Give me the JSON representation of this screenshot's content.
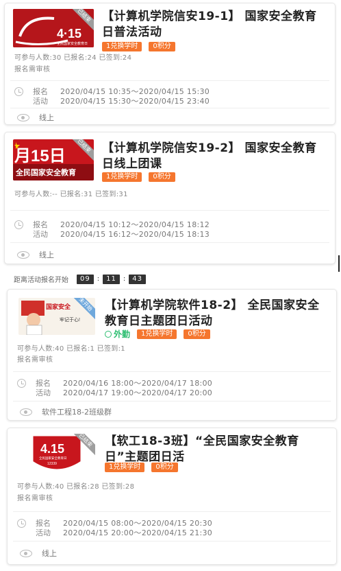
{
  "activities": [
    {
      "title": "【计算机学院信安19-1】 国家安全教育日普法活动",
      "status": "已结束",
      "thumb_text": "4·15",
      "thumb_sub": "全民国家安全教育日",
      "tags": [
        "1兑换学时",
        "0积分"
      ],
      "stats": "可参与人数:30  已报名:24  已签到:24",
      "review": "报名需审核",
      "signup_label": "报名",
      "signup_time": "2020/04/15 10:35～2020/04/15 15:30",
      "activity_label": "活动",
      "activity_time": "2020/04/15 15:30～2020/04/15 23:40",
      "location": "线上"
    },
    {
      "title": "【计算机学院信安19-2】 国家安全教育日线上团课",
      "status": "已结束",
      "thumb_text": "月15日",
      "thumb_sub": "全民国家安全教育",
      "tags": [
        "1兑换学时",
        "0积分"
      ],
      "stats": "可参与人数:--  已报名:31  已签到:31",
      "signup_label": "报名",
      "signup_time": "2020/04/15 10:12～2020/04/15 18:12",
      "activity_label": "活动",
      "activity_time": "2020/04/15 16:12～2020/04/15 18:13",
      "location": "线上"
    },
    {
      "title": "【计算机学院软件18-2】 全民国家安全教育日主题团日活动",
      "status": "未开始",
      "thumb_text": "国家安全",
      "thumb_sub": "牢记于心!",
      "outwork": "外勤",
      "tags": [
        "1兑换学时",
        "0积分"
      ],
      "stats": "可参与人数:40  已报名:1  已签到:1",
      "review": "报名需审核",
      "signup_label": "报名",
      "signup_time": "2020/04/16 18:00～2020/04/17 18:00",
      "activity_label": "活动",
      "activity_time": "2020/04/17 19:00～2020/04/17 20:00",
      "location": "软件工程18-2班级群"
    },
    {
      "title": "【软工18-3班】“全民国家安全教育日”主题团日活",
      "status": "已结束",
      "thumb_text": "4.15",
      "thumb_sub": "全民国家安全教育日",
      "thumb_sub2": "12339",
      "tags": [
        "1兑换学时",
        "0积分"
      ],
      "stats": "可参与人数:40  已报名:28  已签到:28",
      "review": "报名需审核",
      "signup_label": "报名",
      "signup_time": "2020/04/15 08:00～2020/04/15 20:30",
      "activity_label": "活动",
      "activity_time": "2020/04/15 20:00～2020/04/15 21:30",
      "location": "线上"
    }
  ],
  "countdown": {
    "label": "距离活动报名开始",
    "hours": "09",
    "minutes": "11",
    "seconds": "43"
  },
  "colors": {
    "tag_bg": "#f5762e",
    "outwork": "#2bbd6f",
    "ended_ribbon": "#9e9e9e",
    "thumb_red": "#c8161d"
  }
}
